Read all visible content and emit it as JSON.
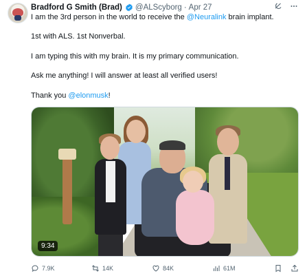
{
  "tweet": {
    "author_name": "Bradford G Smith (Brad)",
    "handle": "@ALScyborg",
    "separator": "·",
    "date": "Apr 27",
    "lines": {
      "p1_before": "I am the 3rd person in the world to receive the ",
      "p1_link": "@Neuralink",
      "p1_after": " brain implant.",
      "p2": "1st with ALS. 1st Nonverbal.",
      "p3": "I am typing this with my brain. It is my primary communication.",
      "p4": "Ask me anything! I will answer at least all verified users!",
      "p5_before": "Thank you ",
      "p5_link": "@elonmusk",
      "p5_after": "!"
    },
    "video_duration": "9:34",
    "stats": {
      "replies": "7.9K",
      "reposts": "14K",
      "likes": "84K",
      "views": "61M"
    },
    "colors": {
      "link": "#1d9bf0",
      "verified": "#1d9bf0",
      "muted": "#536471"
    },
    "icons": [
      "grok-icon",
      "more-icon",
      "reply-icon",
      "repost-icon",
      "like-icon",
      "views-icon",
      "bookmark-icon",
      "share-icon"
    ]
  }
}
